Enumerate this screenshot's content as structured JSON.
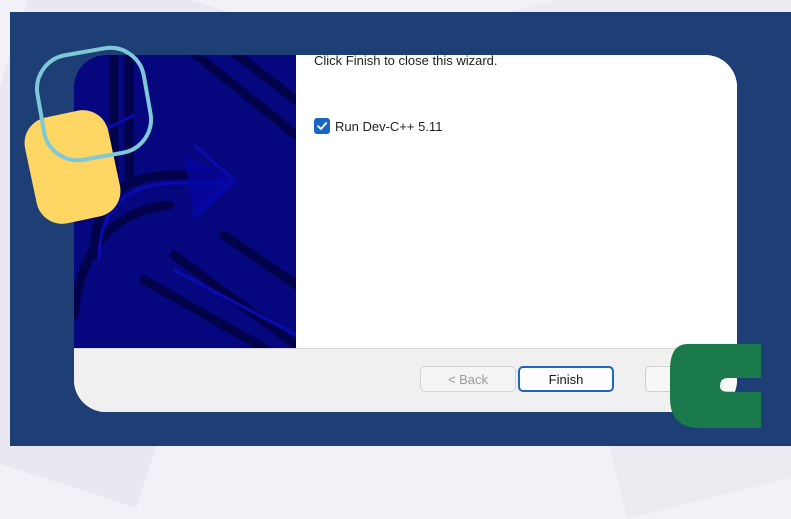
{
  "wizard": {
    "intro_text": "Click Finish to close this wizard.",
    "run_checkbox": {
      "label": "Run Dev-C++ 5.11",
      "checked": true
    },
    "buttons": {
      "back": "< Back",
      "finish": "Finish",
      "cancel": "C"
    }
  },
  "colors": {
    "frame": "#1e3f75",
    "side_art": "#06067e",
    "accent_blue": "#1a64c4",
    "yellow_deco": "#fdd663",
    "teal_outline": "#7ec8d8",
    "green_deco": "#1b7a4c"
  },
  "icons": {
    "checkbox": "check-mark-icon",
    "side_art": "installer-arrow-art",
    "corner_logo": "green-c-logo"
  }
}
